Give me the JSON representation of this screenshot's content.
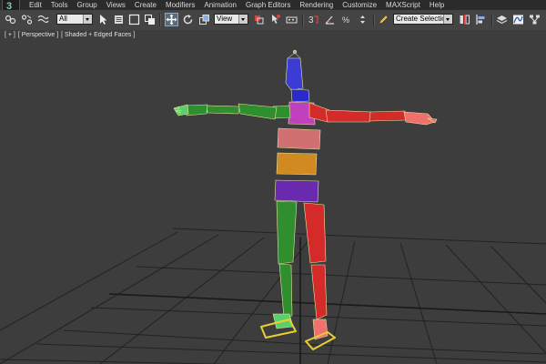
{
  "menubar": {
    "items": [
      "Edit",
      "Tools",
      "Group",
      "Views",
      "Create",
      "Modifiers",
      "Animation",
      "Graph Editors",
      "Rendering",
      "Customize",
      "MAXScript",
      "Help"
    ]
  },
  "toolbar": {
    "selection_filter": "All",
    "reference_coordinate": "View",
    "snap_label": "3",
    "percent_snap_label": "%",
    "named_selection_placeholder": "Create Selection Se",
    "active_tool": "select-and-move"
  },
  "viewport": {
    "label_plus": "[ + ]",
    "label_view": "[ Perspective ]",
    "label_shading": "[ Shaded + Edged Faces ]"
  },
  "colors": {
    "left_limbs": "#2f8f2f",
    "right_limbs": "#d42a2a",
    "head": "#3b3bd6",
    "neck": "#2a2acc",
    "chest": "#c040c0",
    "spine": "#d07070",
    "abdomen": "#d08a20",
    "pelvis": "#6a2ab0",
    "feet": "#e8d030",
    "grid": "#1f1f1f",
    "background": "#3d3d3d"
  }
}
